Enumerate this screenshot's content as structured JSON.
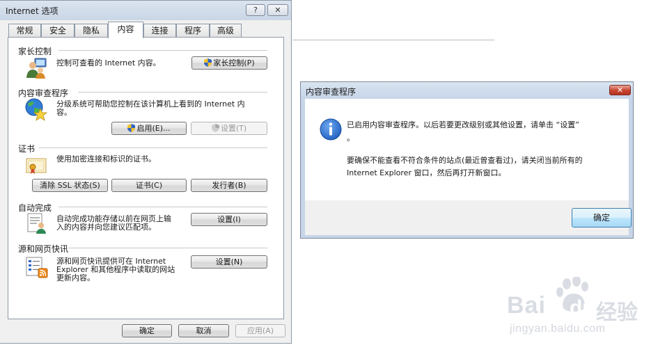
{
  "options_dialog": {
    "title": "Internet 选项",
    "help_label": "?",
    "close_label": "✕",
    "tabs": [
      {
        "label": "常规"
      },
      {
        "label": "安全"
      },
      {
        "label": "隐私"
      },
      {
        "label": "内容"
      },
      {
        "label": "连接"
      },
      {
        "label": "程序"
      },
      {
        "label": "高级"
      }
    ],
    "active_tab": "内容",
    "family_safety": {
      "title": "家长控制",
      "description": "控制可查看的 Internet 内容。",
      "button": "家长控制(P)"
    },
    "content_advisor": {
      "title": "内容审查程序",
      "description_line1": "分级系统可帮助您控制在该计算机上看到的 Internet 内",
      "description_line2": "容。",
      "enable_button": "启用(E)...",
      "settings_button": "设置(T)"
    },
    "certificates": {
      "title": "证书",
      "description": "使用加密连接和标识的证书。",
      "clear_ssl_button": "清除 SSL 状态(S)",
      "certificates_button": "证书(C)",
      "publishers_button": "发行者(B)"
    },
    "autocomplete": {
      "title": "自动完成",
      "description_line1": "自动完成功能存储以前在网页上输",
      "description_line2": "入的内容并向您建议匹配项。",
      "settings_button": "设置(I)"
    },
    "feeds": {
      "title": "源和网页快讯",
      "description_line1": "源和网页快讯提供可在 Internet",
      "description_line2": "Explorer 和其他程序中读取的网站",
      "description_line3": "更新内容。",
      "settings_button": "设置(N)"
    },
    "footer": {
      "ok": "确定",
      "cancel": "取消",
      "apply": "应用(A)"
    }
  },
  "advisor_dialog": {
    "title": "内容审查程序",
    "close_label": "✕",
    "message_line1": "已启用内容审查程序。以后若要更改级别或其他设置，请单击 “设置”",
    "message_line2": "。",
    "message_line3": "要确保不能查看不符合条件的站点(最近曾查看过)，请关闭当前所有的",
    "message_line4": "Internet Explorer 窗口，然后再打开新窗口。",
    "ok": "确定"
  },
  "watermark": {
    "brand": "Bai",
    "brand_cn": "经验",
    "url": "jingyan.baidu.com"
  },
  "colors": {
    "accent_blue": "#3c7fb1",
    "close_red": "#c7442f",
    "info_blue": "#1f5fbf"
  }
}
